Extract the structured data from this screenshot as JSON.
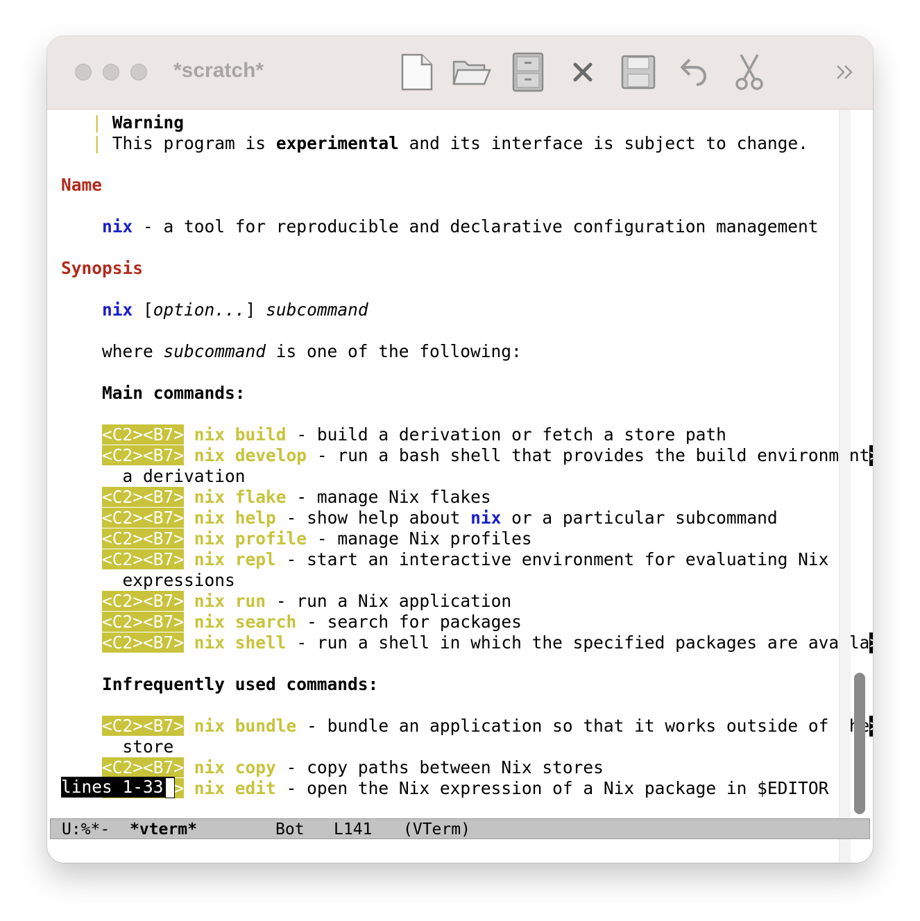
{
  "window": {
    "title": "*scratch*",
    "toolbar": [
      "new-file-icon",
      "open-folder-icon",
      "file-cabinet-icon",
      "close-icon",
      "save-icon",
      "undo-icon",
      "cut-icon",
      "overflow-icon"
    ]
  },
  "doc": {
    "warning_title": "Warning",
    "warning_pre": "This program is ",
    "warning_bold": "experimental",
    "warning_post": " and its interface is subject to change.",
    "name_heading": "Name",
    "name_cmd": "nix",
    "name_desc": " - a tool for reproducible and declarative configuration management",
    "synopsis_heading": "Synopsis",
    "syn_cmd": "nix",
    "syn_open": " [",
    "syn_option": "option...",
    "syn_close": "] ",
    "syn_sub": "subcommand",
    "where_pre": "where ",
    "where_sub": "subcommand",
    "where_post": " is one of the following:",
    "main_heading": "Main commands:",
    "infreq_heading": "Infrequently used commands:",
    "tag": "<C2><B7>",
    "truncation_marker": ">",
    "help_nix": "nix",
    "main": [
      {
        "cmd": "nix build",
        "desc": " - build a derivation or fetch a store path"
      },
      {
        "cmd": "nix develop",
        "desc": " - run a bash shell that provides the build environment",
        "cont": "a derivation"
      },
      {
        "cmd": "nix flake",
        "desc": " - manage Nix flakes"
      },
      {
        "cmd": "nix help",
        "desc": " - show help about ",
        "desc_post": " or a particular subcommand"
      },
      {
        "cmd": "nix profile",
        "desc": " - manage Nix profiles"
      },
      {
        "cmd": "nix repl",
        "desc": " - start an interactive environment for evaluating Nix",
        "cont": "expressions"
      },
      {
        "cmd": "nix run",
        "desc": " - run a Nix application"
      },
      {
        "cmd": "nix search",
        "desc": " - search for packages"
      },
      {
        "cmd": "nix shell",
        "desc": " - run a shell in which the specified packages are availa"
      }
    ],
    "infreq": [
      {
        "cmd": "nix bundle",
        "desc": " - bundle an application so that it works outside of the",
        "cont": "store"
      },
      {
        "cmd": "nix copy",
        "desc": " - copy paths between Nix stores"
      },
      {
        "cmd": "nix edit",
        "desc": " - open the Nix expression of a Nix package in $EDITOR"
      }
    ]
  },
  "echo": "lines 1-33",
  "modeline": {
    "state": "U:%*-",
    "buffer": "*vterm*",
    "position": "Bot",
    "line": "L141",
    "mode": "(VTerm)"
  }
}
